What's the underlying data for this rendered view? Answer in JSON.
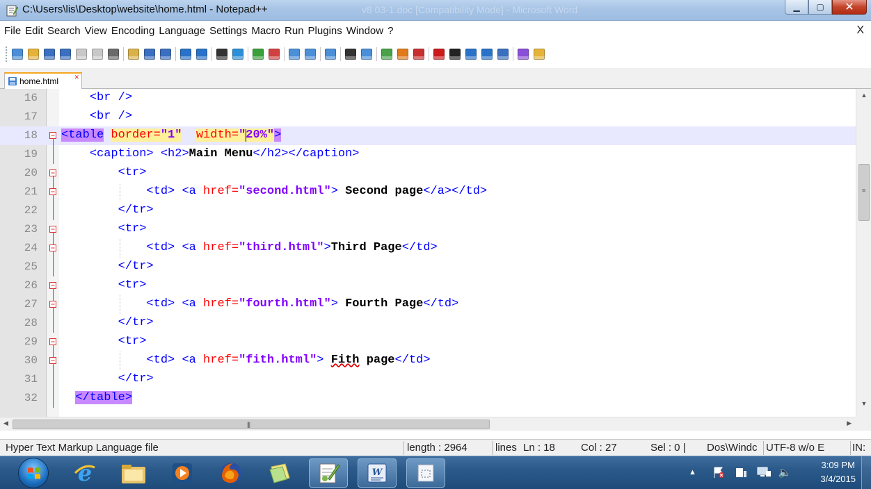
{
  "window": {
    "title": "C:\\Users\\lis\\Desktop\\website\\home.html - Notepad++",
    "background_title": "v8 03-1.doc [Compatibility Mode] - Microsoft Word"
  },
  "menu": {
    "items": [
      "File",
      "Edit",
      "Search",
      "View",
      "Encoding",
      "Language",
      "Settings",
      "Macro",
      "Run",
      "Plugins",
      "Window",
      "?"
    ],
    "close": "X"
  },
  "toolbar": {
    "buttons": [
      {
        "icon": "new-file-icon",
        "color": "#4a8fd8"
      },
      {
        "icon": "open-file-icon",
        "color": "#e5b23a"
      },
      {
        "icon": "save-icon",
        "color": "#3b6fbf"
      },
      {
        "icon": "save-all-icon",
        "color": "#3b6fbf"
      },
      {
        "icon": "close-file-icon",
        "color": "#c8c8c8"
      },
      {
        "icon": "close-all-icon",
        "color": "#c8c8c8"
      },
      {
        "icon": "print-icon",
        "color": "#6a6a6a"
      },
      {
        "icon": "cut-icon",
        "color": "#d9b24a"
      },
      {
        "icon": "copy-icon",
        "color": "#3b6fbf"
      },
      {
        "icon": "paste-icon",
        "color": "#3b6fbf"
      },
      {
        "icon": "undo-icon",
        "color": "#2a72c9"
      },
      {
        "icon": "redo-icon",
        "color": "#2a72c9"
      },
      {
        "icon": "find-icon",
        "color": "#333333"
      },
      {
        "icon": "replace-icon",
        "color": "#2a8fd8"
      },
      {
        "icon": "zoom-in-icon",
        "color": "#3aa13a"
      },
      {
        "icon": "zoom-out-icon",
        "color": "#d04040"
      },
      {
        "icon": "sync-vertical-icon",
        "color": "#4a8fd8"
      },
      {
        "icon": "sync-horizontal-icon",
        "color": "#4a8fd8"
      },
      {
        "icon": "word-wrap-icon",
        "color": "#4a8fd8"
      },
      {
        "icon": "show-all-characters-icon",
        "color": "#333333"
      },
      {
        "icon": "indent-guide-icon",
        "color": "#4a8fd8"
      },
      {
        "icon": "user-language-icon",
        "color": "#4aa14a"
      },
      {
        "icon": "document-map-icon",
        "color": "#e07a1a"
      },
      {
        "icon": "function-list-icon",
        "color": "#c83030"
      },
      {
        "icon": "record-macro-icon",
        "color": "#cc1a1a"
      },
      {
        "icon": "stop-recording-icon",
        "color": "#222222"
      },
      {
        "icon": "play-macro-icon",
        "color": "#2a72c9"
      },
      {
        "icon": "run-macro-multiple-icon",
        "color": "#2a72c9"
      },
      {
        "icon": "save-macro-icon",
        "color": "#3b6fbf"
      },
      {
        "icon": "spell-check-icon",
        "color": "#8a4fd8"
      },
      {
        "icon": "spell-check-settings-icon",
        "color": "#e5b23a"
      }
    ]
  },
  "tabs": [
    {
      "label": "home.html",
      "close_glyph": "✕",
      "active": true
    }
  ],
  "editor": {
    "current_line": 18,
    "lines": [
      {
        "num": "16",
        "segments": [
          {
            "t": "    "
          },
          {
            "t": "<br />",
            "c": "tag"
          }
        ]
      },
      {
        "num": "17",
        "segments": [
          {
            "t": "    "
          },
          {
            "t": "<br />",
            "c": "tag"
          }
        ]
      },
      {
        "num": "18",
        "segments": [
          {
            "t": "<",
            "c": "tag-hl"
          },
          {
            "t": "table",
            "c": "tag-hl"
          },
          {
            "t": " "
          },
          {
            "t": "border=",
            "c": "attr-hl"
          },
          {
            "t": "\"1\"",
            "c": "str-hl"
          },
          {
            "t": "  "
          },
          {
            "t": "width=",
            "c": "attr-hl"
          },
          {
            "t": "\"20%\"",
            "c": "str-hl"
          },
          {
            "t": ">",
            "c": "tag-hl"
          }
        ]
      },
      {
        "num": "19",
        "segments": [
          {
            "t": "    "
          },
          {
            "t": "<caption>",
            "c": "tag"
          },
          {
            "t": " "
          },
          {
            "t": "<h2>",
            "c": "tag"
          },
          {
            "t": "Main Menu",
            "c": "bold"
          },
          {
            "t": "</h2></caption>",
            "c": "tag"
          }
        ]
      },
      {
        "num": "20",
        "segments": [
          {
            "t": "        "
          },
          {
            "t": "<tr>",
            "c": "tag"
          }
        ]
      },
      {
        "num": "21",
        "segments": [
          {
            "t": "            "
          },
          {
            "t": "<td>",
            "c": "tag"
          },
          {
            "t": " "
          },
          {
            "t": "<a ",
            "c": "tag"
          },
          {
            "t": "href=",
            "c": "attr"
          },
          {
            "t": "\"second.html\"",
            "c": "str"
          },
          {
            "t": ">",
            "c": "tag"
          },
          {
            "t": " Second page",
            "c": "bold"
          },
          {
            "t": "</a></td>",
            "c": "tag"
          }
        ]
      },
      {
        "num": "22",
        "segments": [
          {
            "t": "        "
          },
          {
            "t": "</tr>",
            "c": "tag"
          }
        ]
      },
      {
        "num": "23",
        "segments": [
          {
            "t": "        "
          },
          {
            "t": "<tr>",
            "c": "tag"
          }
        ]
      },
      {
        "num": "24",
        "segments": [
          {
            "t": "            "
          },
          {
            "t": "<td>",
            "c": "tag"
          },
          {
            "t": " "
          },
          {
            "t": "<a ",
            "c": "tag"
          },
          {
            "t": "href=",
            "c": "attr"
          },
          {
            "t": "\"third.html\"",
            "c": "str"
          },
          {
            "t": ">",
            "c": "tag"
          },
          {
            "t": "Third Page",
            "c": "bold"
          },
          {
            "t": "</td>",
            "c": "tag"
          }
        ]
      },
      {
        "num": "25",
        "segments": [
          {
            "t": "        "
          },
          {
            "t": "</tr>",
            "c": "tag"
          }
        ]
      },
      {
        "num": "26",
        "segments": [
          {
            "t": "        "
          },
          {
            "t": "<tr>",
            "c": "tag"
          }
        ]
      },
      {
        "num": "27",
        "segments": [
          {
            "t": "            "
          },
          {
            "t": "<td>",
            "c": "tag"
          },
          {
            "t": " "
          },
          {
            "t": "<a ",
            "c": "tag"
          },
          {
            "t": "href=",
            "c": "attr"
          },
          {
            "t": "\"fourth.html\"",
            "c": "str"
          },
          {
            "t": ">",
            "c": "tag"
          },
          {
            "t": " Fourth Page",
            "c": "bold"
          },
          {
            "t": "</td>",
            "c": "tag"
          }
        ]
      },
      {
        "num": "28",
        "segments": [
          {
            "t": "        "
          },
          {
            "t": "</tr>",
            "c": "tag"
          }
        ]
      },
      {
        "num": "29",
        "segments": [
          {
            "t": "        "
          },
          {
            "t": "<tr>",
            "c": "tag"
          }
        ]
      },
      {
        "num": "30",
        "segments": [
          {
            "t": "            "
          },
          {
            "t": "<td>",
            "c": "tag"
          },
          {
            "t": " "
          },
          {
            "t": "<a ",
            "c": "tag"
          },
          {
            "t": "href=",
            "c": "attr"
          },
          {
            "t": "\"fith.html\"",
            "c": "str-squiggle"
          },
          {
            "t": ">",
            "c": "tag"
          },
          {
            "t": " "
          },
          {
            "t": "Fith",
            "c": "bold-squiggle"
          },
          {
            "t": " page",
            "c": "bold"
          },
          {
            "t": "</td>",
            "c": "tag"
          }
        ]
      },
      {
        "num": "31",
        "segments": [
          {
            "t": "        "
          },
          {
            "t": "</tr>",
            "c": "tag"
          }
        ]
      },
      {
        "num": "32",
        "segments": [
          {
            "t": "  "
          },
          {
            "t": "</table",
            "c": "tag-hl"
          },
          {
            "t": ">",
            "c": "tag-hl"
          }
        ]
      }
    ]
  },
  "statusbar": {
    "file_type": "Hyper Text Markup Language file",
    "length": "length : 2964",
    "lines": "lines",
    "ln": "Ln : 18",
    "col": "Col : 27",
    "sel": "Sel : 0 |",
    "eol": "Dos\\Windc",
    "encoding": "UTF-8 w/o E",
    "mode": "IN:"
  },
  "taskbar": {
    "apps": [
      {
        "name": "internet-explorer-icon",
        "open": false
      },
      {
        "name": "file-explorer-icon",
        "open": false
      },
      {
        "name": "media-player-icon",
        "open": false
      },
      {
        "name": "firefox-icon",
        "open": false
      },
      {
        "name": "sticky-notes-icon",
        "open": false
      },
      {
        "name": "notepad-plus-plus-icon",
        "open": true
      },
      {
        "name": "microsoft-word-icon",
        "open": true
      },
      {
        "name": "snipping-tool-icon",
        "open": true
      }
    ],
    "clock_time": "3:09 PM",
    "clock_date": "3/4/2015",
    "tray_icons": [
      "show-hidden-icons-icon",
      "action-center-flag-icon",
      "devices-icon",
      "network-icon",
      "volume-icon"
    ]
  }
}
